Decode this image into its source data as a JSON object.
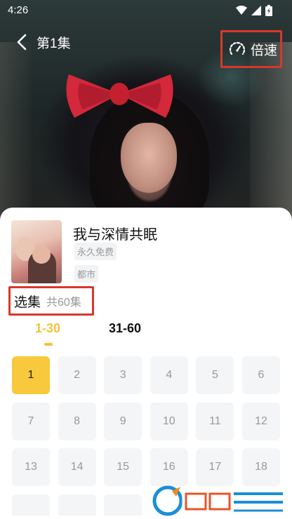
{
  "status_bar": {
    "time": "4:26"
  },
  "header": {
    "back_icon": "chevron-left-icon",
    "episode_title": "第1集",
    "speed_icon": "speedometer-icon",
    "speed_label": "倍速"
  },
  "drama": {
    "title": "我与深情共眠",
    "tags": [
      "永久免费",
      "都市"
    ]
  },
  "episode_selector": {
    "label": "选集",
    "count": "共60集",
    "ranges": [
      "1-30",
      "31-60"
    ],
    "active_range": "1-30",
    "episodes": [
      "1",
      "2",
      "3",
      "4",
      "5",
      "6",
      "7",
      "8",
      "9",
      "10",
      "11",
      "12",
      "13",
      "14",
      "15",
      "16",
      "17",
      "18"
    ],
    "active_episode": "1"
  },
  "colors": {
    "accent": "#f8c83d",
    "highlight_border": "#d8382c"
  }
}
